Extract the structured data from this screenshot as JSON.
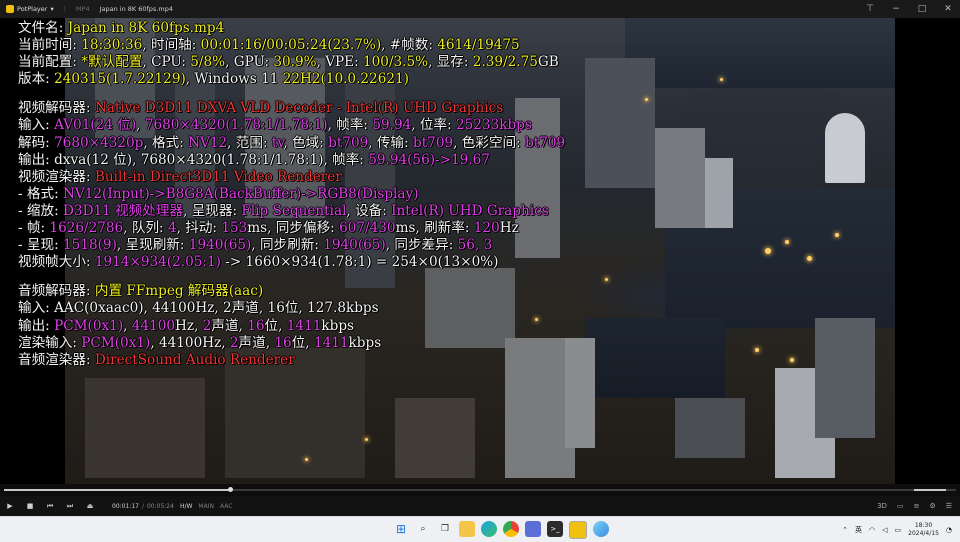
{
  "titlebar": {
    "app_name": "PotPlayer",
    "tab_label": "MP4",
    "file_title": "Japan in 8K 60fps.mp4",
    "window_controls": [
      "pin-icon",
      "minimize-icon",
      "maximize-icon",
      "close-icon"
    ]
  },
  "osd": {
    "file": [
      {
        "t": "文件名: ",
        "c": "w"
      },
      {
        "t": "Japan in 8K 60fps.mp4",
        "c": "y"
      }
    ],
    "time": [
      {
        "t": "当前时间: ",
        "c": "w"
      },
      {
        "t": "18:30:36",
        "c": "y"
      },
      {
        "t": ", 时间轴: ",
        "c": "w"
      },
      {
        "t": "00:01:16/00:05:24(23.7%)",
        "c": "y"
      },
      {
        "t": ", #帧数: ",
        "c": "w"
      },
      {
        "t": "4614/19475",
        "c": "y"
      }
    ],
    "config": [
      {
        "t": "当前配置: ",
        "c": "w"
      },
      {
        "t": "*默认配置",
        "c": "y"
      },
      {
        "t": ", CPU: ",
        "c": "w"
      },
      {
        "t": "5/8%",
        "c": "y"
      },
      {
        "t": ", GPU: ",
        "c": "w"
      },
      {
        "t": "30.9%",
        "c": "y"
      },
      {
        "t": ", VPE: ",
        "c": "w"
      },
      {
        "t": "100/3.5%",
        "c": "y"
      },
      {
        "t": ", 显存: ",
        "c": "w"
      },
      {
        "t": "2.39/2.75",
        "c": "y"
      },
      {
        "t": "GB",
        "c": "w"
      }
    ],
    "version": [
      {
        "t": "版本: ",
        "c": "w"
      },
      {
        "t": "240315(1.7.22129)",
        "c": "y"
      },
      {
        "t": ", Windows 11 ",
        "c": "w"
      },
      {
        "t": "22H2(10.0.22621)",
        "c": "y"
      }
    ],
    "vdec": [
      {
        "t": "视频解码器: ",
        "c": "w"
      },
      {
        "t": "Native D3D11 DXVA VLD Decoder - Intel(R) UHD Graphics",
        "c": "r"
      }
    ],
    "vin": [
      {
        "t": "输入: ",
        "c": "w"
      },
      {
        "t": "AV01(24 位)",
        "c": "m"
      },
      {
        "t": ", ",
        "c": "w"
      },
      {
        "t": "7680×4320(1.78:1/1.78:1)",
        "c": "m"
      },
      {
        "t": ", 帧率: ",
        "c": "w"
      },
      {
        "t": "59.94",
        "c": "m"
      },
      {
        "t": ", 位率: ",
        "c": "w"
      },
      {
        "t": "25233kbps",
        "c": "m"
      }
    ],
    "vdecl": [
      {
        "t": "解码: ",
        "c": "w"
      },
      {
        "t": "7680×4320p",
        "c": "m"
      },
      {
        "t": ", 格式: ",
        "c": "w"
      },
      {
        "t": "NV12",
        "c": "m"
      },
      {
        "t": ", 范围: ",
        "c": "w"
      },
      {
        "t": "tv",
        "c": "m"
      },
      {
        "t": ", 色域: ",
        "c": "w"
      },
      {
        "t": "bt709",
        "c": "m"
      },
      {
        "t": ", 传输: ",
        "c": "w"
      },
      {
        "t": "bt709",
        "c": "m"
      },
      {
        "t": ", 色彩空间: ",
        "c": "w"
      },
      {
        "t": "bt709",
        "c": "m"
      }
    ],
    "vout": [
      {
        "t": "输出: ",
        "c": "w"
      },
      {
        "t": "dxva(12 位), 7680×4320(1.78:1/1.78:1), 帧率: ",
        "c": "w"
      },
      {
        "t": "59.94(56)->19.67",
        "c": "m"
      }
    ],
    "vrend": [
      {
        "t": "视频渲染器: ",
        "c": "w"
      },
      {
        "t": "Built-in Direct3D11 Video Renderer",
        "c": "r"
      }
    ],
    "vfmt": [
      {
        "t": " - 格式: ",
        "c": "w"
      },
      {
        "t": "NV12(Input)->B8G8A(BackBuffer)->RGB8(Display)",
        "c": "m"
      }
    ],
    "vscale": [
      {
        "t": " - 缩放: ",
        "c": "w"
      },
      {
        "t": "D3D11 视频处理器",
        "c": "m"
      },
      {
        "t": ", 呈现器: ",
        "c": "w"
      },
      {
        "t": "Flip Sequential",
        "c": "m"
      },
      {
        "t": ", 设备: ",
        "c": "w"
      },
      {
        "t": "Intel(R) UHD Graphics",
        "c": "m"
      }
    ],
    "vframe": [
      {
        "t": " - 帧: ",
        "c": "w"
      },
      {
        "t": "1626/2786",
        "c": "m"
      },
      {
        "t": ", 队列: ",
        "c": "w"
      },
      {
        "t": "4",
        "c": "m"
      },
      {
        "t": ", 抖动: ",
        "c": "w"
      },
      {
        "t": "153",
        "c": "m"
      },
      {
        "t": "ms, 同步偏移: ",
        "c": "w"
      },
      {
        "t": "607/430",
        "c": "m"
      },
      {
        "t": "ms, 刷新率: ",
        "c": "w"
      },
      {
        "t": "120",
        "c": "m"
      },
      {
        "t": "Hz",
        "c": "w"
      }
    ],
    "vpres": [
      {
        "t": " - 呈现: ",
        "c": "w"
      },
      {
        "t": "1518(9)",
        "c": "m"
      },
      {
        "t": ", 呈现刷新: ",
        "c": "w"
      },
      {
        "t": "1940(65)",
        "c": "m"
      },
      {
        "t": ", 同步刷新: ",
        "c": "w"
      },
      {
        "t": "1940(65)",
        "c": "m"
      },
      {
        "t": ", 同步差异: ",
        "c": "w"
      },
      {
        "t": "56, 3",
        "c": "m"
      }
    ],
    "vsize": [
      {
        "t": "视频帧大小: ",
        "c": "w"
      },
      {
        "t": "1914×934(2.05:1)",
        "c": "m"
      },
      {
        "t": " -> 1660×934(1.78:1) = 254×0(13×0%)",
        "c": "w"
      }
    ],
    "adec": [
      {
        "t": "音频解码器: ",
        "c": "w"
      },
      {
        "t": "内置 FFmpeg 解码器(aac)",
        "c": "y"
      }
    ],
    "ain": [
      {
        "t": "输入: AAC(0xaac0), 44100Hz, 2声道, 16位, 127.8kbps",
        "c": "w"
      }
    ],
    "aout": [
      {
        "t": "输出: ",
        "c": "w"
      },
      {
        "t": "PCM(0x1)",
        "c": "m"
      },
      {
        "t": ", ",
        "c": "w"
      },
      {
        "t": "44100",
        "c": "m"
      },
      {
        "t": "Hz, ",
        "c": "w"
      },
      {
        "t": "2",
        "c": "m"
      },
      {
        "t": "声道, ",
        "c": "w"
      },
      {
        "t": "16",
        "c": "m"
      },
      {
        "t": "位, ",
        "c": "w"
      },
      {
        "t": "1411",
        "c": "m"
      },
      {
        "t": "kbps",
        "c": "w"
      }
    ],
    "arin": [
      {
        "t": "渲染输入: ",
        "c": "w"
      },
      {
        "t": "PCM(0x1)",
        "c": "m"
      },
      {
        "t": ", 44100Hz, ",
        "c": "w"
      },
      {
        "t": "2",
        "c": "m"
      },
      {
        "t": "声道, ",
        "c": "w"
      },
      {
        "t": "16",
        "c": "m"
      },
      {
        "t": "位, ",
        "c": "w"
      },
      {
        "t": "1411",
        "c": "m"
      },
      {
        "t": "kbps",
        "c": "w"
      }
    ],
    "arend": [
      {
        "t": "音频渲染器: ",
        "c": "w"
      },
      {
        "t": "DirectSound Audio Renderer",
        "c": "r"
      }
    ]
  },
  "player": {
    "progress": 0.237,
    "volume": 0.85,
    "current_time": "00:01:17",
    "total_time": "00:05:24",
    "tags": [
      "H/W",
      "MAIN",
      "AAC"
    ],
    "buttons": [
      "play-icon",
      "stop-icon",
      "prev-icon",
      "next-icon",
      "eject-icon"
    ],
    "right_buttons": [
      "3d-icon",
      "subtitle-icon",
      "equalizer-icon",
      "settings-icon",
      "playlist-icon"
    ]
  },
  "taskbar": {
    "apps": [
      "windows-start-icon",
      "search-icon",
      "task-view-icon",
      "explorer-icon",
      "edge-icon",
      "chrome-icon",
      "store-icon",
      "terminal-icon",
      "potplayer-icon",
      "photos-icon"
    ],
    "lang": "英",
    "time": "18:30",
    "date": "2024/4/15"
  },
  "colors": {
    "yellow": "#eeee22",
    "magenta": "#e040e8",
    "red": "#f03636",
    "white": "#f4f4f4"
  }
}
